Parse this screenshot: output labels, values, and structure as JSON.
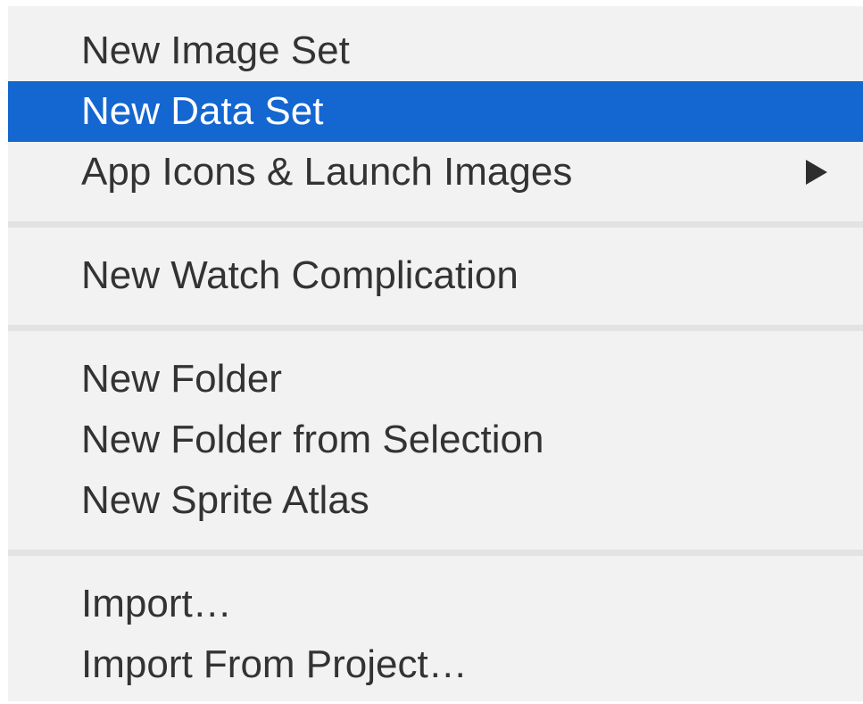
{
  "menu": {
    "groups": [
      {
        "items": [
          {
            "label": "New Image Set"
          },
          {
            "label": "New Data Set",
            "selected": true
          },
          {
            "label": "App Icons & Launch Images",
            "submenu": true
          }
        ]
      },
      {
        "items": [
          {
            "label": "New Watch Complication"
          }
        ]
      },
      {
        "items": [
          {
            "label": "New Folder"
          },
          {
            "label": "New Folder from Selection"
          },
          {
            "label": "New Sprite Atlas"
          }
        ]
      },
      {
        "items": [
          {
            "label": "Import…"
          },
          {
            "label": "Import From Project…"
          }
        ]
      }
    ],
    "colors": {
      "background": "#f2f2f2",
      "highlight": "#1466d0",
      "text": "#333333",
      "separator": "#e3e3e3"
    }
  }
}
